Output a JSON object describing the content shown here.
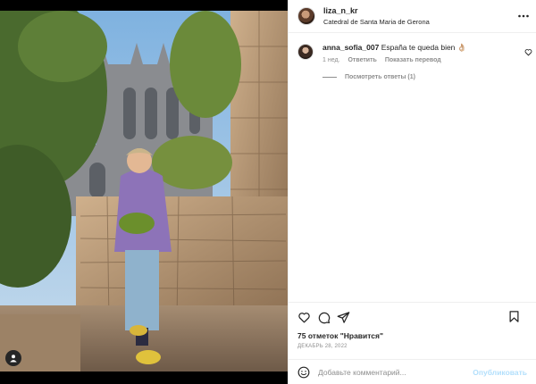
{
  "post": {
    "username": "liza_n_kr",
    "location": "Catedral de Santa Maria de Gerona",
    "more_icon": "more-horizontal-icon",
    "user_tag_icon": "person-icon"
  },
  "comments": [
    {
      "username": "anna_sofia_007",
      "text": "España te queda bien 👌🏼",
      "age": "1 нед.",
      "reply_label": "Ответить",
      "translate_label": "Показать перевод",
      "view_replies": "Посмотреть ответы (1)"
    }
  ],
  "actions": {
    "like_icon": "heart-icon",
    "comment_icon": "comment-icon",
    "share_icon": "send-icon",
    "save_icon": "bookmark-icon"
  },
  "likes": "75 отметок \"Нравится\"",
  "date": "ДЕКАБРЬ 28, 2022",
  "composer": {
    "placeholder": "Добавьте комментарий...",
    "publish_label": "Опубликовать",
    "emoji_icon": "smiley-icon"
  },
  "colors": {
    "text": "#262626",
    "secondary": "#8e8e8e",
    "border": "#efefef",
    "publish_disabled": "#b2dffc"
  }
}
